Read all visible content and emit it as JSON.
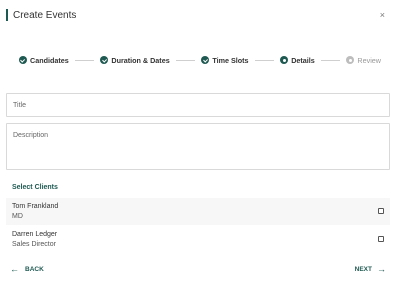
{
  "dialog": {
    "title": "Create Events",
    "close_symbol": "×"
  },
  "stepper": {
    "steps": [
      {
        "label": "Candidates",
        "state": "completed",
        "icon": "check-icon"
      },
      {
        "label": "Duration & Dates",
        "state": "completed",
        "icon": "check-icon"
      },
      {
        "label": "Time Slots",
        "state": "completed",
        "icon": "check-icon"
      },
      {
        "label": "Details",
        "state": "current",
        "icon": "current-step-icon"
      },
      {
        "label": "Review",
        "state": "pending",
        "icon": "pending-step-icon"
      }
    ]
  },
  "form": {
    "title_placeholder": "Title",
    "description_placeholder": "Description",
    "clients_label": "Select Clients",
    "clients": [
      {
        "name": "Tom Frankland",
        "role": "MD",
        "checked": false
      },
      {
        "name": "Darren Ledger",
        "role": "Sales Director",
        "checked": false
      }
    ]
  },
  "footer": {
    "back_label": "BACK",
    "next_label": "NEXT",
    "back_icon": "arrow-left-icon",
    "next_icon": "arrow-right-icon"
  },
  "colors": {
    "accent": "#1f5a52",
    "pending": "#bdbdbd"
  }
}
